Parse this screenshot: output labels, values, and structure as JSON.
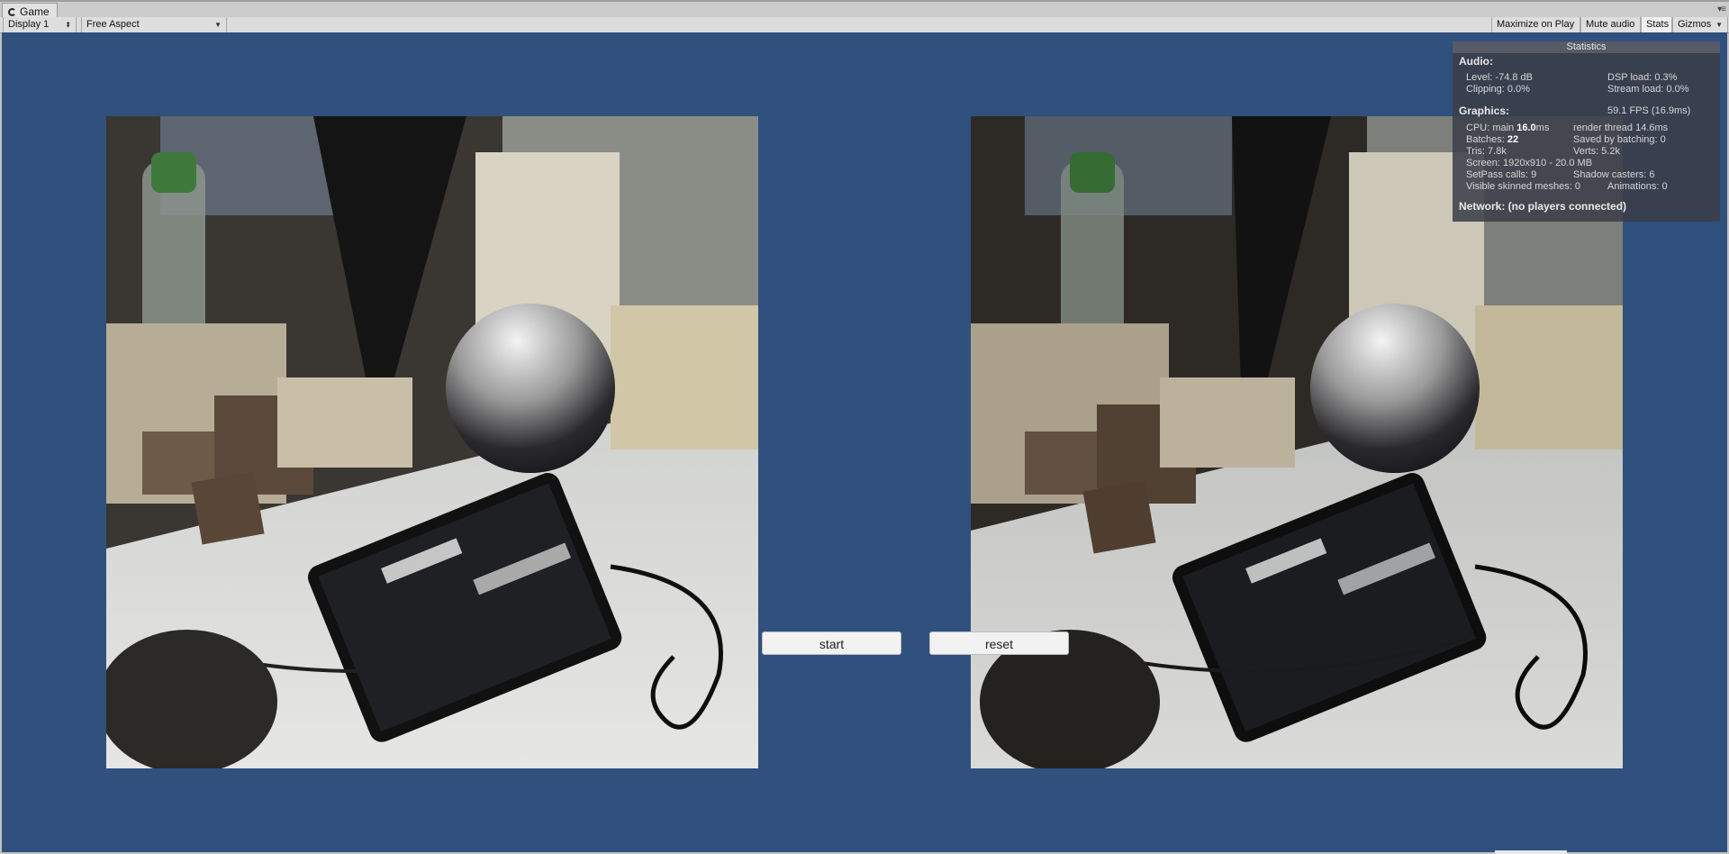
{
  "window": {
    "tab_title": "Game",
    "menu_icon": "menu-icon"
  },
  "toolbar": {
    "display": "Display 1",
    "aspect": "Free Aspect",
    "maximize": "Maximize on Play",
    "mute": "Mute audio",
    "stats": "Stats",
    "gizmos": "Gizmos"
  },
  "buttons": {
    "start": "start",
    "reset": "reset"
  },
  "stats": {
    "title": "Statistics",
    "audio_header": "Audio:",
    "level": "Level: -74.8 dB",
    "clipping": "Clipping: 0.0%",
    "dsp": "DSP load: 0.3%",
    "stream": "Stream load: 0.0%",
    "graphics_header": "Graphics:",
    "fps": "59.1 FPS (16.9ms)",
    "cpu_label": "CPU: main ",
    "cpu_value": "16.0",
    "cpu_unit": "ms",
    "render_thread": "render thread 14.6ms",
    "batches_label": "Batches: ",
    "batches_value": "22",
    "saved": "Saved by batching: 0",
    "tris": "Tris: 7.8k",
    "verts": "Verts: 5.2k",
    "screen": "Screen: 1920x910 - 20.0 MB",
    "setpass": "SetPass calls: 9",
    "shadow": "Shadow casters: 6",
    "skinned": "Visible skinned meshes: 0",
    "animations": "Animations: 0",
    "network": "Network: (no players connected)"
  },
  "colors": {
    "viewport_bg": "#30507d",
    "panel_bg": "#3a3e48"
  },
  "views": {
    "left": "camera-feed-left",
    "right": "camera-feed-right"
  }
}
